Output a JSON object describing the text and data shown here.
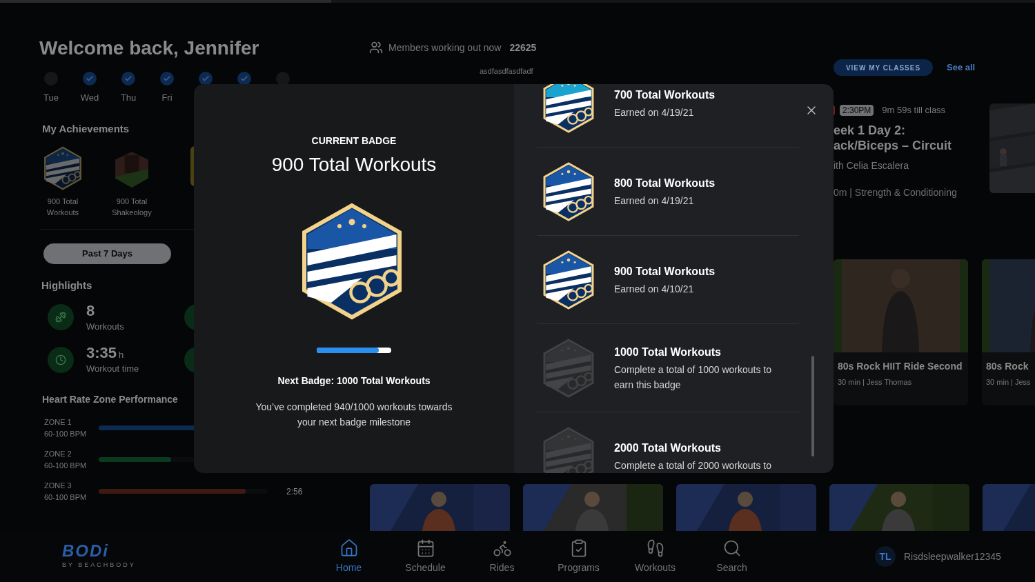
{
  "top_progress": {
    "level": 0.32
  },
  "welcome": "Welcome back, Jennifer",
  "week": [
    {
      "day": "Tue",
      "done": false
    },
    {
      "day": "Wed",
      "done": true
    },
    {
      "day": "Thu",
      "done": true
    },
    {
      "day": "Fri",
      "done": true
    },
    {
      "done": true
    },
    {
      "done": true
    },
    {
      "done": false
    }
  ],
  "achievements": {
    "title": "My Achievements",
    "badges": [
      {
        "kind": "workouts",
        "label": "900 Total Workouts"
      },
      {
        "kind": "shakeology",
        "label": "900 Total Shakeology"
      },
      {
        "kind": "number"
      }
    ]
  },
  "range_button": "Past 7 Days",
  "highlights": {
    "title": "Highlights",
    "items": [
      {
        "kind": "workouts",
        "value": "8",
        "label": "Workouts"
      },
      {
        "kind": "time",
        "value": "3:35",
        "unit": "h",
        "label": "Workout time"
      }
    ]
  },
  "heart_rate": {
    "title": "Heart Rate Zone Performance",
    "zones": [
      {
        "name": "ZONE 1",
        "range": "60-100 BPM",
        "level": 0.95,
        "color": "#0d2a52"
      },
      {
        "name": "ZONE 2",
        "range": "60-100 BPM",
        "level": 0.43,
        "color": "#0b3a1f"
      },
      {
        "name": "ZONE 3",
        "range": "60-100 BPM",
        "level": 0.87,
        "color": "#3f1a12",
        "duration": "2:56"
      }
    ]
  },
  "members": {
    "label": "Members working out now",
    "count": "22625"
  },
  "tag_text": "asdfasdfasdfadf",
  "view_classes_button": "VIEW MY CLASSES",
  "see_all": "See all",
  "live_class": {
    "time": "2:30PM",
    "countdown": "9m 59s till class",
    "title_lines": [
      "eek 1 Day 2:",
      "ack/Biceps – Circuit"
    ],
    "instructor": "ith Celia Escalera",
    "meta": "0m | Strength & Conditioning"
  },
  "video_cards": [
    {
      "title": "80s Rock HIIT Ride Second",
      "meta": "30 min | Jess Thomas"
    },
    {
      "title": "80s Rock",
      "meta": "30 min | Jess"
    }
  ],
  "nav": {
    "logo": "BODi",
    "logo_sub": "BY BEACHBODY",
    "items": [
      {
        "kind": "home",
        "label": "Home",
        "selected": true
      },
      {
        "kind": "schedule",
        "label": "Schedule",
        "selected": false
      },
      {
        "kind": "rides",
        "label": "Rides",
        "selected": false
      },
      {
        "kind": "programs",
        "label": "Programs",
        "selected": false
      },
      {
        "kind": "workouts",
        "label": "Workouts",
        "selected": false
      },
      {
        "kind": "search",
        "label": "Search",
        "selected": false
      }
    ],
    "user": {
      "initials": "TL",
      "name": "Risdsleepwalker12345"
    }
  },
  "modal": {
    "current_label": "CURRENT BADGE",
    "title": "900 Total Workouts",
    "color": "#1a56a6",
    "progress": {
      "level": 0.83
    },
    "next_badge": "Next Badge: 1000 Total Workouts",
    "description": "You’ve completed 940/1000 workouts towards your next badge milestone",
    "badges": [
      {
        "title": "700 Total Workouts",
        "subtitle": "Earned on 4/19/21",
        "earned": true,
        "color": "#1aa3cf"
      },
      {
        "title": "800 Total Workouts",
        "subtitle": "Earned on 4/19/21",
        "earned": true,
        "color": "#1a56a6"
      },
      {
        "title": "900 Total Workouts",
        "subtitle": "Earned on 4/10/21",
        "earned": true,
        "color": "#1a56a6"
      },
      {
        "title": "1000 Total Workouts",
        "subtitle": "Complete a total of 1000 workouts to earn this badge",
        "earned": false,
        "color": "#38393b"
      },
      {
        "title": "2000 Total Workouts",
        "subtitle": "Complete a total of 2000 workouts to",
        "earned": false,
        "color": "#38393b"
      }
    ]
  }
}
